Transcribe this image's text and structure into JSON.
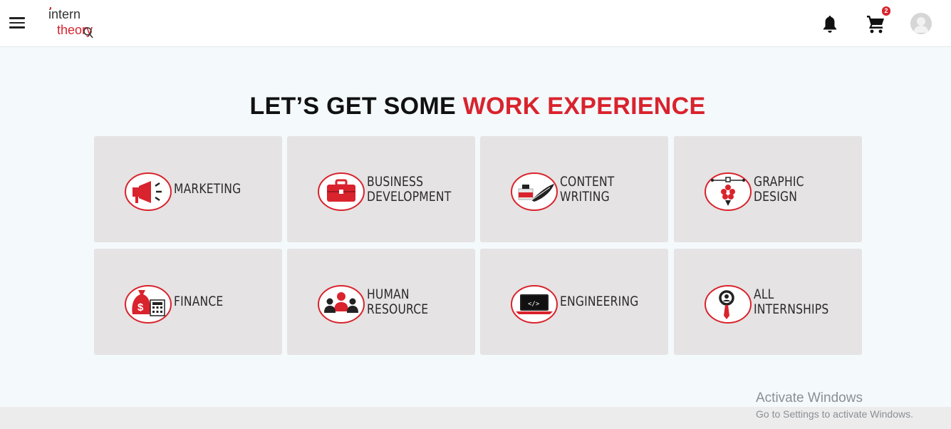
{
  "header": {
    "logo_text_top": "intern",
    "logo_text_bottom": "theory",
    "cart_count": "2",
    "brand_color": "#d9232d"
  },
  "main": {
    "heading_dark": "LET’S GET SOME",
    "heading_accent": "WORK EXPERIENCE",
    "categories": [
      {
        "label": "MARKETING",
        "icon": "megaphone-icon"
      },
      {
        "label": "BUSINESS\nDEVELOPMENT",
        "icon": "briefcase-icon"
      },
      {
        "label": "CONTENT\nWRITING",
        "icon": "ink-quill-icon"
      },
      {
        "label": "GRAPHIC\nDESIGN",
        "icon": "pen-tool-icon"
      },
      {
        "label": "FINANCE",
        "icon": "money-bag-calculator-icon"
      },
      {
        "label": "HUMAN\nRESOURCE",
        "icon": "people-group-icon"
      },
      {
        "label": "ENGINEERING",
        "icon": "laptop-code-icon"
      },
      {
        "label": "ALL\nINTERNSHIPS",
        "icon": "search-tie-icon"
      }
    ]
  },
  "watermark": {
    "line1": "Activate Windows",
    "line2": "Go to Settings to activate Windows."
  }
}
